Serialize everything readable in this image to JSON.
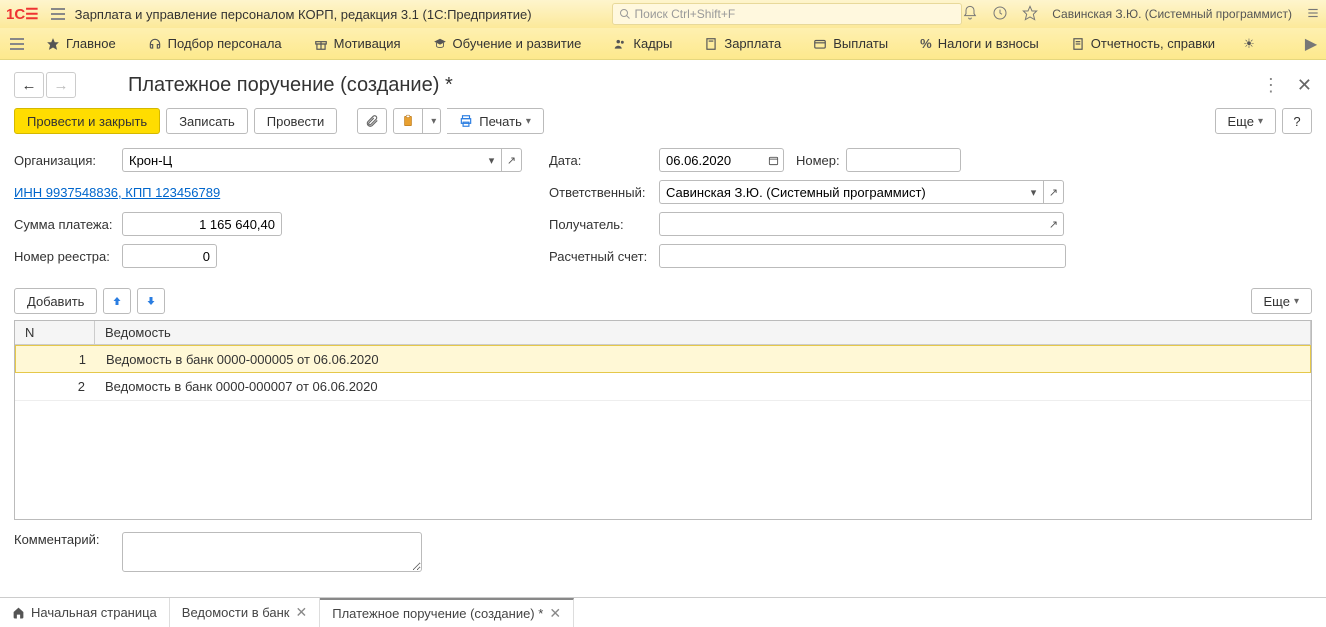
{
  "app": {
    "title": "Зарплата и управление персоналом КОРП, редакция 3.1  (1С:Предприятие)",
    "search_placeholder": "Поиск Ctrl+Shift+F",
    "username": "Савинская З.Ю. (Системный программист)"
  },
  "menu": {
    "items": [
      "Главное",
      "Подбор персонала",
      "Мотивация",
      "Обучение и развитие",
      "Кадры",
      "Зарплата",
      "Выплаты",
      "Налоги и взносы",
      "Отчетность, справки"
    ]
  },
  "page": {
    "title": "Платежное поручение (создание) *"
  },
  "toolbar": {
    "post_close": "Провести и закрыть",
    "save": "Записать",
    "post": "Провести",
    "print": "Печать",
    "more": "Еще",
    "help": "?"
  },
  "form": {
    "org_label": "Организация:",
    "org_value": "Крон-Ц",
    "date_label": "Дата:",
    "date_value": "06.06.2020",
    "number_label": "Номер:",
    "number_value": "",
    "inn_link": "ИНН 9937548836, КПП 123456789",
    "resp_label": "Ответственный:",
    "resp_value": "Савинская З.Ю. (Системный программист)",
    "sum_label": "Сумма платежа:",
    "sum_value": "1 165 640,40",
    "recipient_label": "Получатель:",
    "recipient_value": "",
    "registry_label": "Номер реестра:",
    "registry_value": "0",
    "account_label": "Расчетный счет:",
    "account_value": ""
  },
  "table": {
    "add": "Добавить",
    "more": "Еще",
    "headers": {
      "n": "N",
      "v": "Ведомость"
    },
    "rows": [
      {
        "n": "1",
        "v": "Ведомость в банк 0000-000005 от 06.06.2020"
      },
      {
        "n": "2",
        "v": "Ведомость в банк 0000-000007 от 06.06.2020"
      }
    ]
  },
  "comment_label": "Комментарий:",
  "tabs": {
    "home": "Начальная страница",
    "t1": "Ведомости в банк",
    "t2": "Платежное поручение (создание) *"
  }
}
